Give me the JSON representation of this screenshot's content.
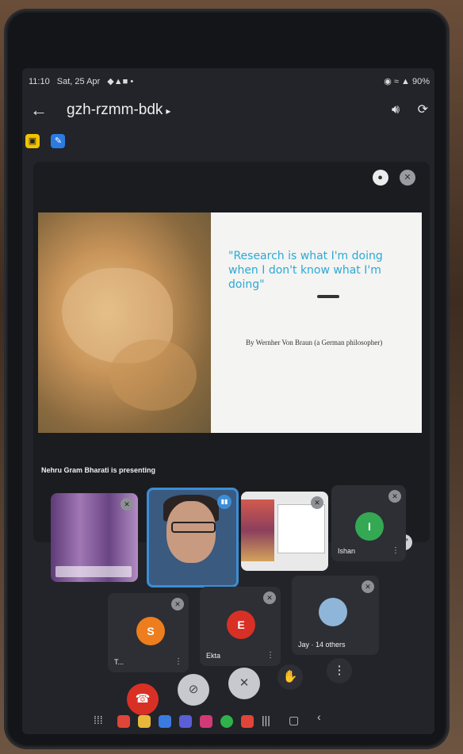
{
  "status": {
    "time": "11:10",
    "date": "Sat, 25 Apr",
    "right": "90%"
  },
  "appbar": {
    "meeting_code": "gzh-rzmm-bdk"
  },
  "slide": {
    "quote": "\"Research is what I'm doing when I don't know what I'm doing\"",
    "author": "By Wernher Von Braun (a German philosopher)"
  },
  "presenting_text": "Nehru Gram Bharati is presenting",
  "participants": [
    {
      "name": "",
      "initial": ""
    },
    {
      "name": "",
      "initial": ""
    },
    {
      "name": "",
      "initial": ""
    },
    {
      "name": "Ishan",
      "initial": "I",
      "color": "#34a853"
    },
    {
      "name": "T...",
      "initial": "S",
      "color": "#ee7d1d"
    },
    {
      "name": "Ekta",
      "initial": "E",
      "color": "#d93025"
    },
    {
      "name": "Jay · 14 others",
      "initial": ""
    }
  ],
  "colors": {
    "end_call": "#d93025",
    "accent": "#3b8ed6"
  }
}
